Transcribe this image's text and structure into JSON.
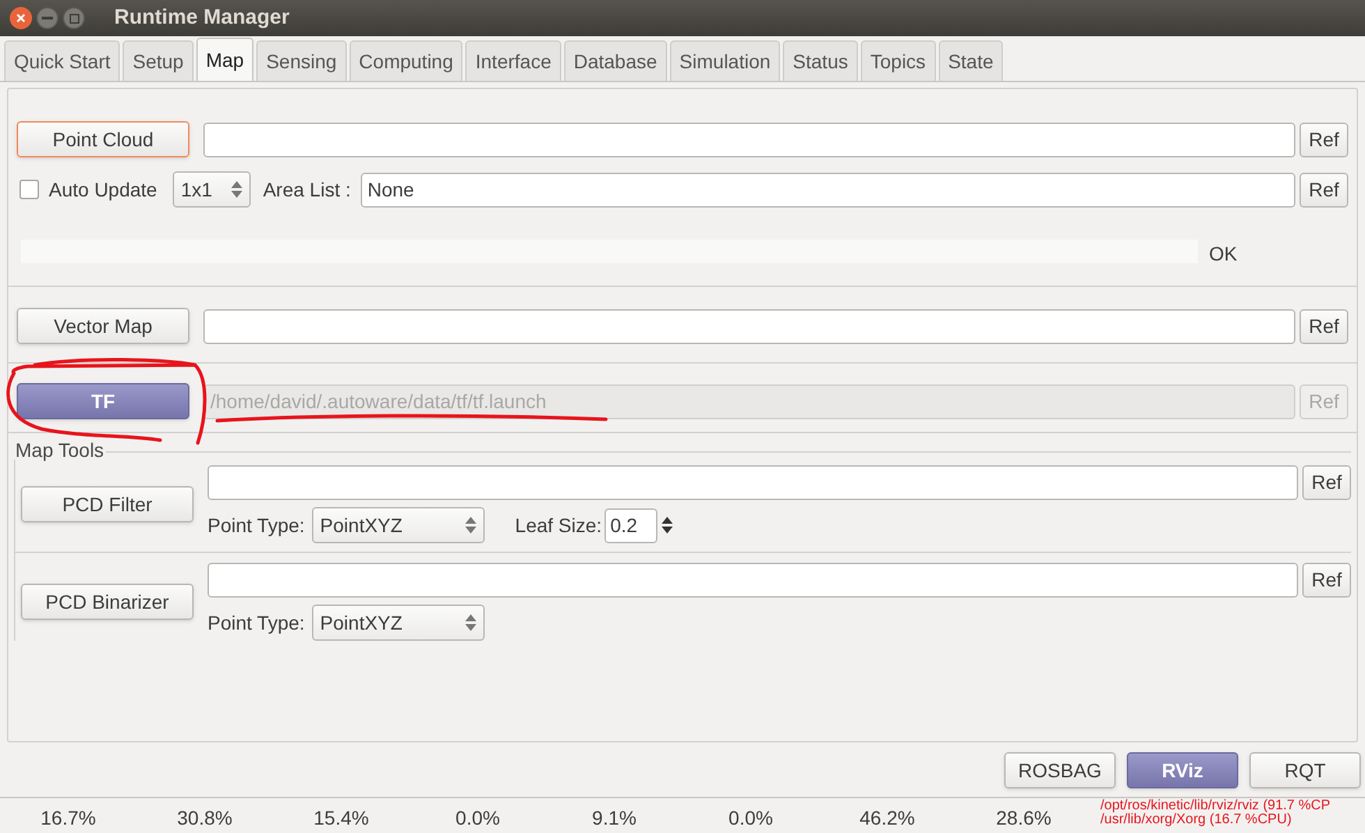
{
  "window": {
    "title": "Runtime Manager"
  },
  "tabs": [
    {
      "label": "Quick Start",
      "selected": false
    },
    {
      "label": "Setup",
      "selected": false
    },
    {
      "label": "Map",
      "selected": true
    },
    {
      "label": "Sensing",
      "selected": false
    },
    {
      "label": "Computing",
      "selected": false
    },
    {
      "label": "Interface",
      "selected": false
    },
    {
      "label": "Database",
      "selected": false
    },
    {
      "label": "Simulation",
      "selected": false
    },
    {
      "label": "Status",
      "selected": false
    },
    {
      "label": "Topics",
      "selected": false
    },
    {
      "label": "State",
      "selected": false
    }
  ],
  "map": {
    "point_cloud": {
      "button": {
        "label": "Point Cloud",
        "focused": true,
        "on": false
      },
      "ref": {
        "label": "Ref",
        "disabled": false
      }
    },
    "auto_update": {
      "label": "Auto Update",
      "checked": false
    },
    "area_size": {
      "value": "1x1"
    },
    "area_list": {
      "label": "Area List :",
      "value": "None",
      "ref": {
        "label": "Ref",
        "disabled": false
      }
    },
    "progress": {
      "level": 0,
      "status": "OK"
    },
    "vector_map": {
      "button": {
        "label": "Vector Map",
        "focused": false,
        "on": false
      },
      "ref": {
        "label": "Ref",
        "disabled": false
      }
    },
    "tf": {
      "button": {
        "label": "TF",
        "focused": false,
        "on": true
      },
      "path": "/home/david/.autoware/data/tf/tf.launch",
      "disabled": true,
      "ref": {
        "label": "Ref",
        "disabled": true
      }
    }
  },
  "map_tools": {
    "title": "Map Tools",
    "tools": [
      {
        "button": {
          "label": "PCD Filter",
          "focused": false,
          "on": false
        },
        "ref": {
          "label": "Ref",
          "disabled": false
        },
        "point_type": {
          "label": "Point Type:",
          "value": "PointXYZ"
        },
        "leaf_size": {
          "label": "Leaf Size:",
          "value": "0.2"
        }
      },
      {
        "button": {
          "label": "PCD Binarizer",
          "focused": false,
          "on": false
        },
        "ref": {
          "label": "Ref",
          "disabled": false
        },
        "point_type": {
          "label": "Point Type:",
          "value": "PointXYZ"
        }
      }
    ]
  },
  "footer_buttons": [
    {
      "label": "ROSBAG",
      "on": false
    },
    {
      "label": "RViz",
      "on": true
    },
    {
      "label": "RQT",
      "on": false
    }
  ],
  "status_bar": {
    "cpu": [
      "16.7%",
      "30.8%",
      "15.4%",
      "0.0%",
      "9.1%",
      "0.0%",
      "46.2%",
      "28.6%"
    ],
    "processes": [
      "/opt/ros/kinetic/lib/rviz/rviz (91.7 %CP",
      "/usr/lib/xorg/Xorg (16.7 %CPU)"
    ]
  }
}
